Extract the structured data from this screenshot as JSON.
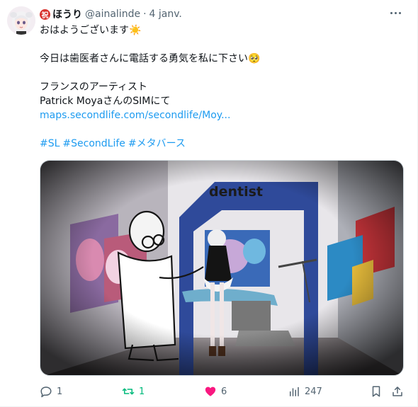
{
  "post": {
    "author": {
      "badge_char": "祝",
      "display_name": "ほうり",
      "handle": "@ainalinde",
      "separator": "·",
      "date": "4 janv."
    },
    "lines": [
      "おはようございます☀️",
      "今日は歯医者さんに電話する勇気を私に下さい🥺",
      "フランスのアーティスト",
      "Patrick MoyaさんのSIMにて"
    ],
    "link_text": "maps.secondlife.com/secondlife/Moy...",
    "hashtags": [
      "#SL",
      "#SecondLife",
      "#メタバース"
    ],
    "media": {
      "sign_text": "dentist"
    },
    "actions": {
      "replies": "1",
      "reposts": "1",
      "likes": "6",
      "views": "247"
    }
  },
  "colors": {
    "text": "#0f1419",
    "secondary": "#536471",
    "link": "#1d9bf0",
    "repost": "#00ba7c",
    "like": "#f91880",
    "badge": "#d8332f"
  }
}
